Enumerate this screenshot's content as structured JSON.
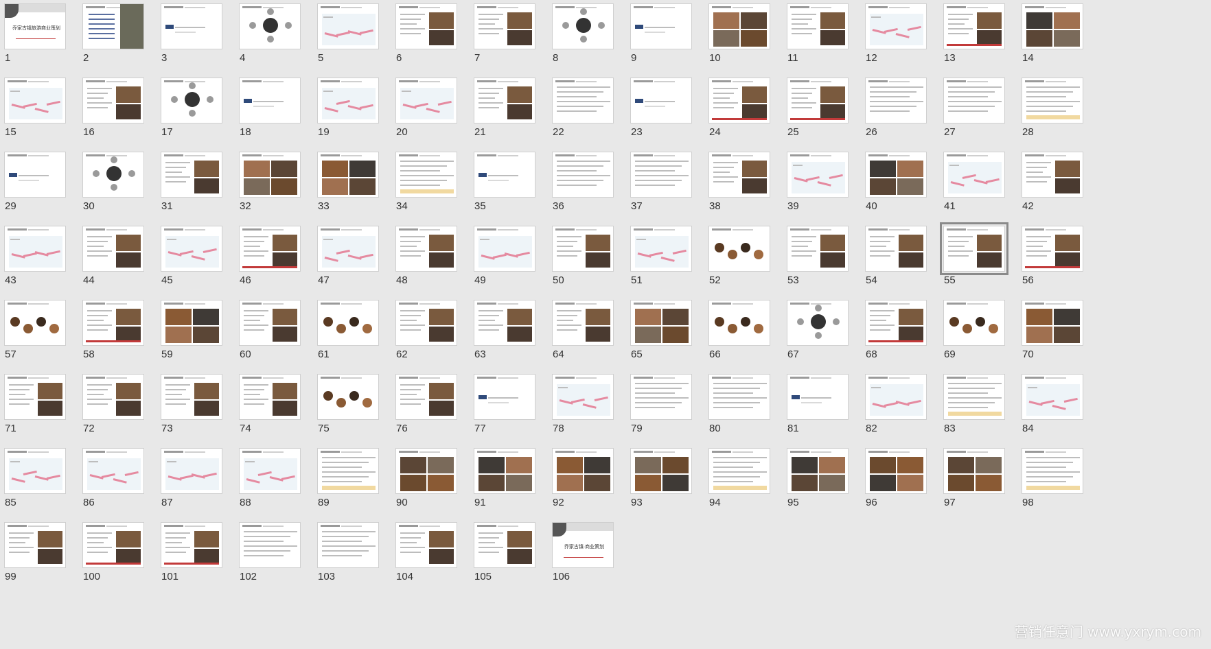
{
  "slides": [
    {
      "n": "1",
      "t": "title",
      "title": "乔家古镇旅游商业策划"
    },
    {
      "n": "2",
      "t": "toc"
    },
    {
      "n": "3",
      "t": "section"
    },
    {
      "n": "4",
      "t": "diagram"
    },
    {
      "n": "5",
      "t": "map"
    },
    {
      "n": "6",
      "t": "text-photo"
    },
    {
      "n": "7",
      "t": "text-photo"
    },
    {
      "n": "8",
      "t": "diagram"
    },
    {
      "n": "9",
      "t": "section"
    },
    {
      "n": "10",
      "t": "photo"
    },
    {
      "n": "11",
      "t": "text-photo"
    },
    {
      "n": "12",
      "t": "map"
    },
    {
      "n": "13",
      "t": "text-photo"
    },
    {
      "n": "14",
      "t": "photo"
    },
    {
      "n": "15",
      "t": "map"
    },
    {
      "n": "16",
      "t": "text-photo"
    },
    {
      "n": "17",
      "t": "diagram"
    },
    {
      "n": "18",
      "t": "section"
    },
    {
      "n": "19",
      "t": "map"
    },
    {
      "n": "20",
      "t": "map"
    },
    {
      "n": "21",
      "t": "text-photo"
    },
    {
      "n": "22",
      "t": "text"
    },
    {
      "n": "23",
      "t": "section"
    },
    {
      "n": "24",
      "t": "text-photo"
    },
    {
      "n": "25",
      "t": "text-photo"
    },
    {
      "n": "26",
      "t": "text"
    },
    {
      "n": "27",
      "t": "text"
    },
    {
      "n": "28",
      "t": "text"
    },
    {
      "n": "29",
      "t": "section"
    },
    {
      "n": "30",
      "t": "diagram"
    },
    {
      "n": "31",
      "t": "text-photo"
    },
    {
      "n": "32",
      "t": "photo"
    },
    {
      "n": "33",
      "t": "photo"
    },
    {
      "n": "34",
      "t": "text"
    },
    {
      "n": "35",
      "t": "section"
    },
    {
      "n": "36",
      "t": "text"
    },
    {
      "n": "37",
      "t": "text"
    },
    {
      "n": "38",
      "t": "text-photo"
    },
    {
      "n": "39",
      "t": "map"
    },
    {
      "n": "40",
      "t": "photo"
    },
    {
      "n": "41",
      "t": "map"
    },
    {
      "n": "42",
      "t": "text-photo"
    },
    {
      "n": "43",
      "t": "map"
    },
    {
      "n": "44",
      "t": "text-photo"
    },
    {
      "n": "45",
      "t": "map"
    },
    {
      "n": "46",
      "t": "text-photo"
    },
    {
      "n": "47",
      "t": "map"
    },
    {
      "n": "48",
      "t": "text-photo"
    },
    {
      "n": "49",
      "t": "map"
    },
    {
      "n": "50",
      "t": "text-photo"
    },
    {
      "n": "51",
      "t": "map"
    },
    {
      "n": "52",
      "t": "circles"
    },
    {
      "n": "53",
      "t": "text-photo"
    },
    {
      "n": "54",
      "t": "text-photo"
    },
    {
      "n": "55",
      "t": "text-photo"
    },
    {
      "n": "56",
      "t": "text-photo"
    },
    {
      "n": "57",
      "t": "circles"
    },
    {
      "n": "58",
      "t": "text-photo"
    },
    {
      "n": "59",
      "t": "photo"
    },
    {
      "n": "60",
      "t": "text-photo"
    },
    {
      "n": "61",
      "t": "circles"
    },
    {
      "n": "62",
      "t": "text-photo"
    },
    {
      "n": "63",
      "t": "text-photo"
    },
    {
      "n": "64",
      "t": "text-photo"
    },
    {
      "n": "65",
      "t": "photo"
    },
    {
      "n": "66",
      "t": "circles"
    },
    {
      "n": "67",
      "t": "diagram"
    },
    {
      "n": "68",
      "t": "text-photo"
    },
    {
      "n": "69",
      "t": "circles"
    },
    {
      "n": "70",
      "t": "photo"
    },
    {
      "n": "71",
      "t": "text-photo"
    },
    {
      "n": "72",
      "t": "text-photo"
    },
    {
      "n": "73",
      "t": "text-photo"
    },
    {
      "n": "74",
      "t": "text-photo"
    },
    {
      "n": "75",
      "t": "circles"
    },
    {
      "n": "76",
      "t": "text-photo"
    },
    {
      "n": "77",
      "t": "section"
    },
    {
      "n": "78",
      "t": "map"
    },
    {
      "n": "79",
      "t": "text"
    },
    {
      "n": "80",
      "t": "text"
    },
    {
      "n": "81",
      "t": "section"
    },
    {
      "n": "82",
      "t": "map"
    },
    {
      "n": "83",
      "t": "text"
    },
    {
      "n": "84",
      "t": "map"
    },
    {
      "n": "85",
      "t": "map"
    },
    {
      "n": "86",
      "t": "map"
    },
    {
      "n": "87",
      "t": "map"
    },
    {
      "n": "88",
      "t": "map"
    },
    {
      "n": "89",
      "t": "text"
    },
    {
      "n": "90",
      "t": "photo"
    },
    {
      "n": "91",
      "t": "photo"
    },
    {
      "n": "92",
      "t": "photo"
    },
    {
      "n": "93",
      "t": "photo"
    },
    {
      "n": "94",
      "t": "text"
    },
    {
      "n": "95",
      "t": "photo"
    },
    {
      "n": "96",
      "t": "photo"
    },
    {
      "n": "97",
      "t": "photo"
    },
    {
      "n": "98",
      "t": "text"
    },
    {
      "n": "99",
      "t": "text-photo"
    },
    {
      "n": "100",
      "t": "text-photo"
    },
    {
      "n": "101",
      "t": "text-photo"
    },
    {
      "n": "102",
      "t": "text"
    },
    {
      "n": "103",
      "t": "text"
    },
    {
      "n": "104",
      "t": "text-photo"
    },
    {
      "n": "105",
      "t": "text-photo"
    },
    {
      "n": "106",
      "t": "closing",
      "title": "乔家古镇·商业策划"
    }
  ],
  "selected": "55",
  "watermark": "营销任意门 www.yxrym.com",
  "colors": {
    "background": "#e8e8e8",
    "selection": "#8a8a8a",
    "route": "#e58aa0"
  }
}
